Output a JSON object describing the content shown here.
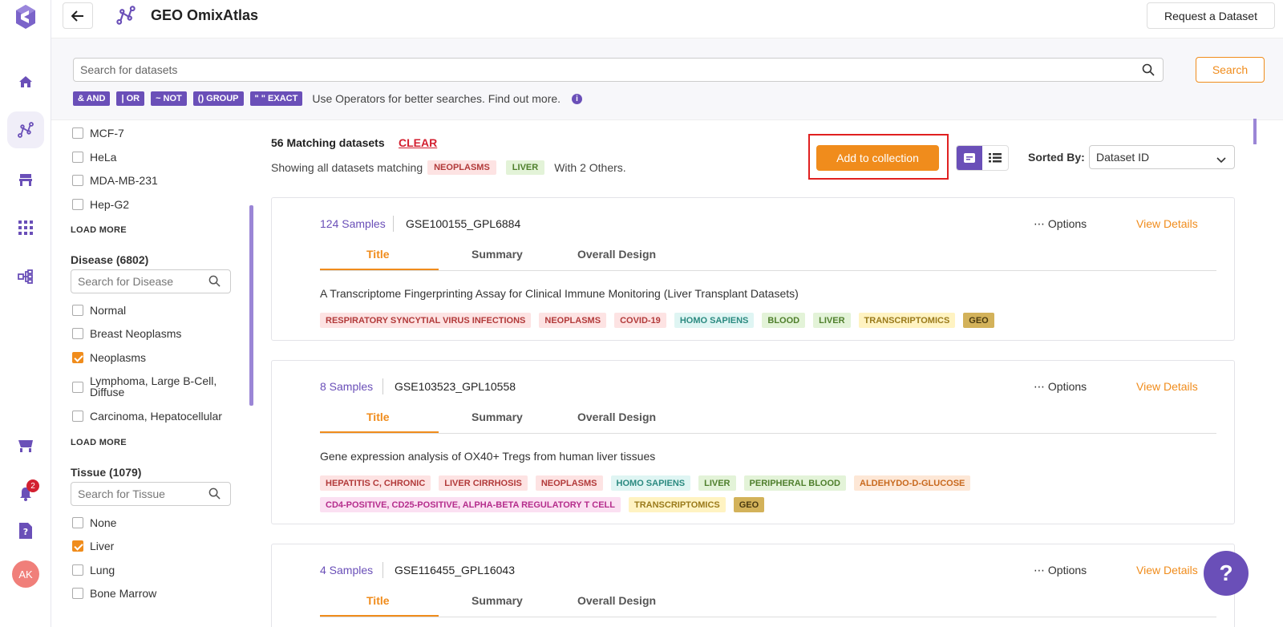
{
  "header": {
    "title": "GEO OmixAtlas",
    "request_label": "Request a Dataset"
  },
  "rail": {
    "notification_count": "2",
    "avatar_initials": "AK"
  },
  "search": {
    "placeholder": "Search for datasets",
    "button_label": "Search",
    "operators": [
      "& AND",
      "| OR",
      "~ NOT",
      "() GROUP",
      "\" \" EXACT"
    ],
    "hint": "Use Operators for better searches. Find out more."
  },
  "filters": {
    "cell_lines": [
      "MCF-7",
      "HeLa",
      "MDA-MB-231",
      "Hep-G2"
    ],
    "load_more": "LOAD MORE",
    "disease": {
      "heading": "Disease (6802)",
      "placeholder": "Search for Disease",
      "items": [
        {
          "label": "Normal",
          "checked": false
        },
        {
          "label": "Breast Neoplasms",
          "checked": false
        },
        {
          "label": "Neoplasms",
          "checked": true
        },
        {
          "label": "Lymphoma, Large B-Cell, Diffuse",
          "checked": false
        },
        {
          "label": "Carcinoma, Hepatocellular",
          "checked": false
        }
      ]
    },
    "tissue": {
      "heading": "Tissue (1079)",
      "placeholder": "Search for Tissue",
      "items": [
        {
          "label": "None",
          "checked": false
        },
        {
          "label": "Liver",
          "checked": true
        },
        {
          "label": "Lung",
          "checked": false
        },
        {
          "label": "Bone Marrow",
          "checked": false
        }
      ]
    }
  },
  "results": {
    "count_label": "56 Matching datasets",
    "clear_label": "CLEAR",
    "showing_prefix": "Showing all datasets matching",
    "active_chips": [
      "NEOPLASMS",
      "LIVER"
    ],
    "others": "With 2 Others.",
    "add_to_collection": "Add to collection",
    "sorted_by_label": "Sorted By:",
    "sort_value": "Dataset ID",
    "tabs": [
      "Title",
      "Summary",
      "Overall Design"
    ],
    "options_label": "Options",
    "details_label": "View Details",
    "cards": [
      {
        "samples": "124 Samples",
        "id": "GSE100155_GPL6884",
        "description": "A Transcriptome Fingerprinting Assay for Clinical Immune Monitoring (Liver Transplant Datasets)",
        "tags": [
          {
            "text": "RESPIRATORY SYNCYTIAL VIRUS INFECTIONS",
            "kind": "red"
          },
          {
            "text": "NEOPLASMS",
            "kind": "red"
          },
          {
            "text": "COVID-19",
            "kind": "red"
          },
          {
            "text": "HOMO SAPIENS",
            "kind": "teal"
          },
          {
            "text": "BLOOD",
            "kind": "green"
          },
          {
            "text": "LIVER",
            "kind": "green"
          },
          {
            "text": "TRANSCRIPTOMICS",
            "kind": "yellow"
          },
          {
            "text": "GEO",
            "kind": "geo"
          }
        ]
      },
      {
        "samples": "8 Samples",
        "id": "GSE103523_GPL10558",
        "description": "Gene expression analysis of OX40+ Tregs from human liver tissues",
        "tags": [
          {
            "text": "HEPATITIS C, CHRONIC",
            "kind": "red"
          },
          {
            "text": "LIVER CIRRHOSIS",
            "kind": "red"
          },
          {
            "text": "NEOPLASMS",
            "kind": "red"
          },
          {
            "text": "HOMO SAPIENS",
            "kind": "teal"
          },
          {
            "text": "LIVER",
            "kind": "green"
          },
          {
            "text": "PERIPHERAL BLOOD",
            "kind": "green"
          },
          {
            "text": "ALDEHYDO-D-GLUCOSE",
            "kind": "orange"
          },
          {
            "text": "CD4-POSITIVE, CD25-POSITIVE, ALPHA-BETA REGULATORY T CELL",
            "kind": "pink"
          },
          {
            "text": "TRANSCRIPTOMICS",
            "kind": "yellow"
          },
          {
            "text": "GEO",
            "kind": "geo"
          }
        ]
      },
      {
        "samples": "4 Samples",
        "id": "GSE116455_GPL16043",
        "description": "",
        "tags": []
      }
    ]
  },
  "help_label": "?"
}
